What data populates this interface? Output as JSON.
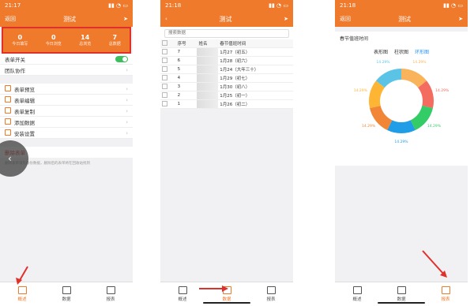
{
  "phones": [
    {
      "status_time": "21:17",
      "nav": {
        "back": "返回",
        "title": "测试"
      },
      "stats": [
        {
          "num": "0",
          "label": "今日填写"
        },
        {
          "num": "0",
          "label": "今日浏览"
        },
        {
          "num": "14",
          "label": "总浏览"
        },
        {
          "num": "7",
          "label": "总数据"
        }
      ],
      "toggle_label": "表单开关",
      "team_label": "团队协作",
      "actions": [
        "表单预览",
        "表单编辑",
        "表单复制",
        "添加数据",
        "安装设置"
      ],
      "delete_label": "删除表单",
      "note": "删除表单请先备份数据，删除后的表单将在回收站找到",
      "tabs": [
        "概述",
        "数据",
        "报表"
      ]
    },
    {
      "status_time": "21:18",
      "nav": {
        "back": "",
        "title": "测试"
      },
      "search_placeholder": "搜索数据",
      "table": {
        "headers": [
          "序号",
          "姓名",
          "春节值班时间"
        ],
        "rows": [
          {
            "id": "7",
            "date": "1月27（初五）"
          },
          {
            "id": "6",
            "date": "1月28（初六）"
          },
          {
            "id": "5",
            "date": "1月24（大年三十）"
          },
          {
            "id": "4",
            "date": "1月29（初七）"
          },
          {
            "id": "3",
            "date": "1月30（初八）"
          },
          {
            "id": "2",
            "date": "1月25（初一）"
          },
          {
            "id": "1",
            "date": "1月26（初二）"
          }
        ]
      },
      "tabs": [
        "概述",
        "数据",
        "报表"
      ]
    },
    {
      "status_time": "21:18",
      "nav": {
        "back": "返回",
        "title": "测试"
      },
      "chart_title": "春节值班时间",
      "chart_tabs": [
        "表形图",
        "柱状图",
        "环形图"
      ],
      "tabs": [
        "概述",
        "数据",
        "报表"
      ]
    }
  ],
  "chart_data": {
    "type": "pie",
    "categories": [
      "",
      "",
      "",
      "",
      "",
      "",
      ""
    ],
    "values": [
      14.29,
      14.29,
      14.29,
      14.29,
      14.29,
      14.29,
      14.29
    ],
    "value_labels": [
      "14.29%",
      "14.29%",
      "14.29%",
      "14.29%",
      "14.29%",
      "14.29%",
      "14.29%"
    ],
    "colors": [
      "#f9b35b",
      "#f46b60",
      "#33cc66",
      "#1f9de6",
      "#f08636",
      "#ffb534",
      "#5bc4e6"
    ]
  }
}
